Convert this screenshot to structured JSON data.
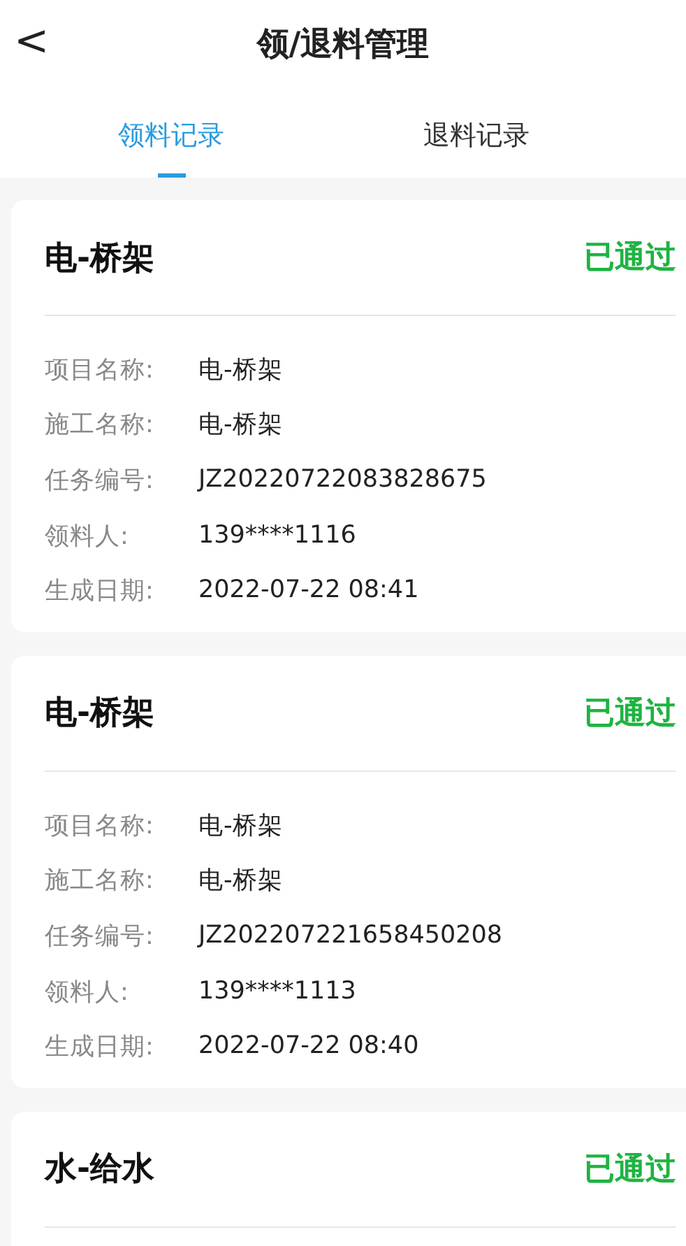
{
  "header": {
    "back": "<",
    "title": "领/退料管理"
  },
  "tabs": [
    {
      "label": "领料记录",
      "selected": true
    },
    {
      "label": "退料记录",
      "selected": false
    }
  ],
  "records": [
    {
      "title": "电-桥架",
      "status": "已通过",
      "fields": [
        {
          "label": "项目名称:",
          "value": "电-桥架"
        },
        {
          "label": "施工名称:",
          "value": "电-桥架"
        },
        {
          "label": "任务编号:",
          "value": "JZ20220722083828675"
        },
        {
          "label": "领料人:",
          "value": "139****1116"
        },
        {
          "label": "生成日期:",
          "value": "2022-07-22 08:41"
        }
      ]
    },
    {
      "title": "电-桥架",
      "status": "已通过",
      "fields": [
        {
          "label": "项目名称:",
          "value": "电-桥架"
        },
        {
          "label": "施工名称:",
          "value": "电-桥架"
        },
        {
          "label": "任务编号:",
          "value": "JZ202207221658450208"
        },
        {
          "label": "领料人:",
          "value": "139****1113"
        },
        {
          "label": "生成日期:",
          "value": "2022-07-22 08:40"
        }
      ]
    },
    {
      "title": "水-给水",
      "status": "已通过"
    }
  ]
}
